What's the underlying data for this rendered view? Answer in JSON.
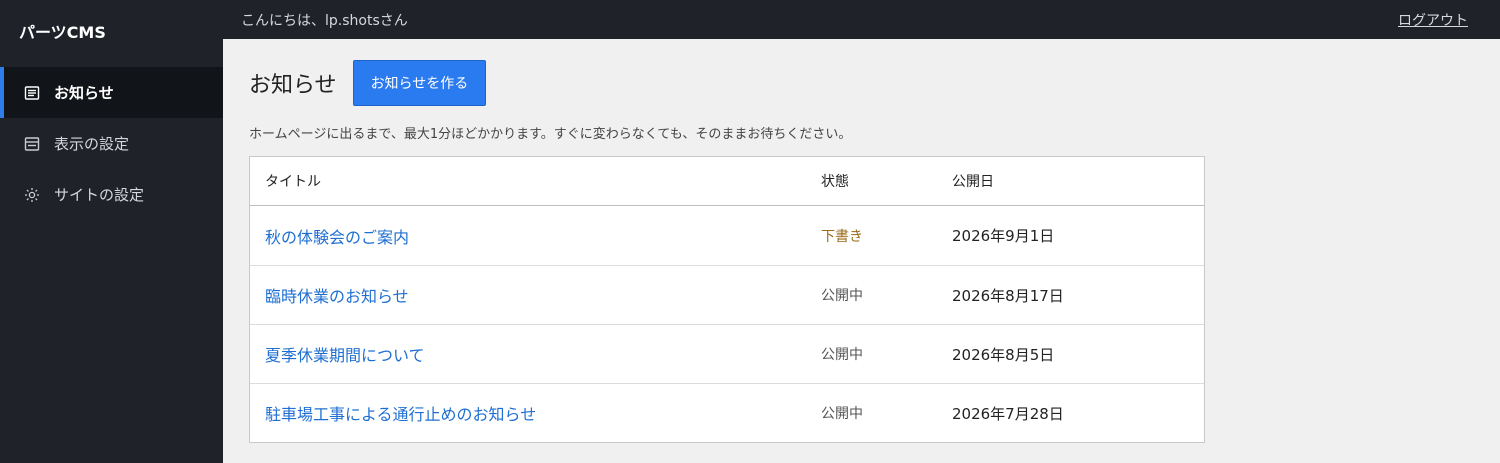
{
  "sidebar": {
    "brand": "パーツCMS",
    "items": [
      {
        "label": "お知らせ",
        "icon": "list-icon",
        "active": true
      },
      {
        "label": "表示の設定",
        "icon": "window-icon",
        "active": false
      },
      {
        "label": "サイトの設定",
        "icon": "gear-icon",
        "active": false
      }
    ]
  },
  "topbar": {
    "greeting": "こんにちは、lp.shotsさん",
    "logout": "ログアウト"
  },
  "main": {
    "title": "お知らせ",
    "create_button": "お知らせを作る",
    "notice": "ホームページに出るまで、最大1分ほどかかります。すぐに変わらなくても、そのままお待ちください。"
  },
  "table": {
    "headers": {
      "title": "タイトル",
      "status": "状態",
      "date": "公開日"
    },
    "rows": [
      {
        "title": "秋の体験会のご案内",
        "status": "下書き",
        "date": "2026年9月1日"
      },
      {
        "title": "臨時休業のお知らせ",
        "status": "公開中",
        "date": "2026年8月17日"
      },
      {
        "title": "夏季休業期間について",
        "status": "公開中",
        "date": "2026年8月5日"
      },
      {
        "title": "駐車場工事による通行止めのお知らせ",
        "status": "公開中",
        "date": "2026年7月28日"
      }
    ]
  },
  "colors": {
    "sidebar_bg": "#1f2329",
    "accent": "#2a7af0",
    "link": "#1f6fd1",
    "draft": "#9a6b1a"
  }
}
